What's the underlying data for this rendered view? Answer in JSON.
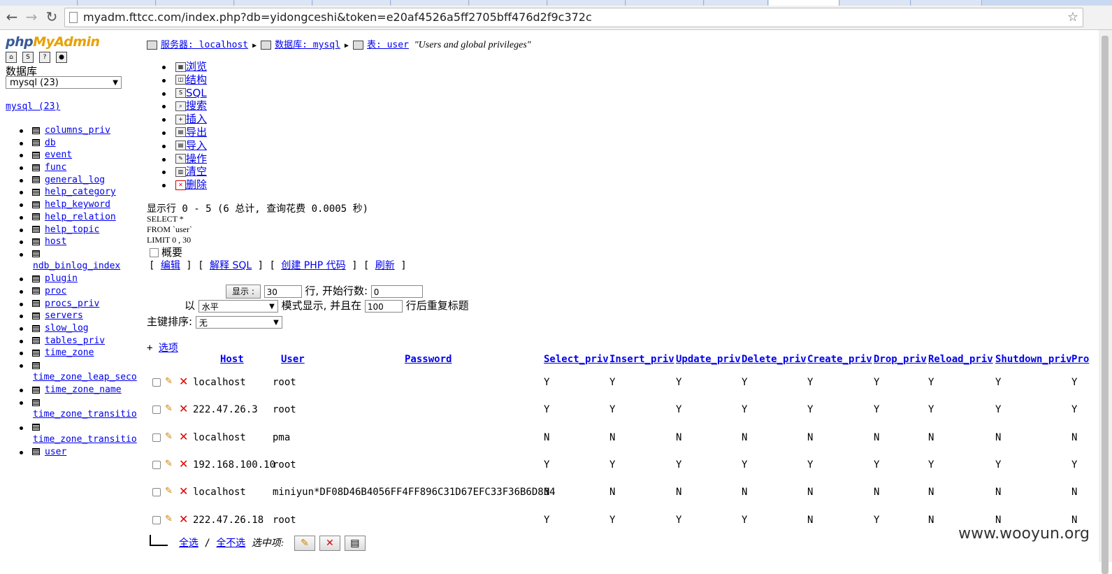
{
  "browser": {
    "url": "myadm.fttcc.com/index.php?db=yidongceshi&token=e20af4526a5ff2705bff476d2f9c372c"
  },
  "sidebar": {
    "logo_php": "php",
    "logo_myadmin": "MyAdmin",
    "db_label": "数据库",
    "db_select": "mysql (23)",
    "db_link": "mysql (23)",
    "tables": [
      "columns_priv",
      "db",
      "event",
      "func",
      "general_log",
      "help_category",
      "help_keyword",
      "help_relation",
      "help_topic",
      "host",
      "ndb_binlog_index",
      "plugin",
      "proc",
      "procs_priv",
      "servers",
      "slow_log",
      "tables_priv",
      "time_zone",
      "time_zone_leap_seco",
      "time_zone_name",
      "time_zone_transitio",
      "time_zone_transitio",
      "user"
    ]
  },
  "breadcrumb": {
    "server": "服务器: localhost",
    "database": "数据库: mysql",
    "table": "表: user",
    "comment": "\"Users and global privileges\""
  },
  "tabs": [
    "浏览",
    "结构",
    "SQL",
    "搜索",
    "插入",
    "导出",
    "导入",
    "操作",
    "清空",
    "删除"
  ],
  "query": {
    "info": "显示行 0 - 5 (6 总计, 查询花费 0.0005 秒)",
    "sql_lines": [
      "SELECT *",
      "FROM `user`",
      "LIMIT 0 , 30"
    ],
    "profile_label": "概要",
    "links": [
      "编辑",
      "解释 SQL",
      "创建 PHP 代码",
      "刷新"
    ]
  },
  "display_form": {
    "show_button": "显示 :",
    "rows_value": "30",
    "rows_label": "行, 开始行数:",
    "start_value": "0",
    "mode_prefix": "以",
    "mode_value": "水平",
    "mode_label": "模式显示, 并且在",
    "repeat_value": "100",
    "repeat_label": "行后重复标题",
    "sort_label": "主键排序:",
    "sort_value": "无",
    "options_link": "选项"
  },
  "table": {
    "columns": [
      "Host",
      "User",
      "Password",
      "Select_priv",
      "Insert_priv",
      "Update_priv",
      "Delete_priv",
      "Create_priv",
      "Drop_priv",
      "Reload_priv",
      "Shutdown_priv",
      "Pro"
    ],
    "rows": [
      {
        "host": "localhost",
        "user": "root",
        "password": "",
        "privs": [
          "Y",
          "Y",
          "Y",
          "Y",
          "Y",
          "Y",
          "Y",
          "Y",
          "Y"
        ]
      },
      {
        "host": "222.47.26.3",
        "user": "root",
        "password": "",
        "privs": [
          "Y",
          "Y",
          "Y",
          "Y",
          "Y",
          "Y",
          "Y",
          "Y",
          "Y"
        ]
      },
      {
        "host": "localhost",
        "user": "pma",
        "password": "",
        "privs": [
          "N",
          "N",
          "N",
          "N",
          "N",
          "N",
          "N",
          "N",
          "N"
        ]
      },
      {
        "host": "192.168.100.10",
        "user": "root",
        "password": "",
        "privs": [
          "Y",
          "Y",
          "Y",
          "Y",
          "Y",
          "Y",
          "Y",
          "Y",
          "Y"
        ]
      },
      {
        "host": "localhost",
        "user": "miniyun",
        "password": "*DF08D46B4056FF4FF896C31D67EFC33F36B6D834",
        "privs": [
          "N",
          "N",
          "N",
          "N",
          "N",
          "N",
          "N",
          "N",
          "N"
        ]
      },
      {
        "host": "222.47.26.18",
        "user": "root",
        "password": "",
        "privs": [
          "Y",
          "Y",
          "Y",
          "Y",
          "N",
          "Y",
          "N",
          "N",
          "N"
        ]
      }
    ]
  },
  "bottom": {
    "select_all": "全选",
    "separator": "/",
    "select_none": "全不选",
    "with_selected": "选中项:"
  },
  "watermark": "www.wooyun.org"
}
